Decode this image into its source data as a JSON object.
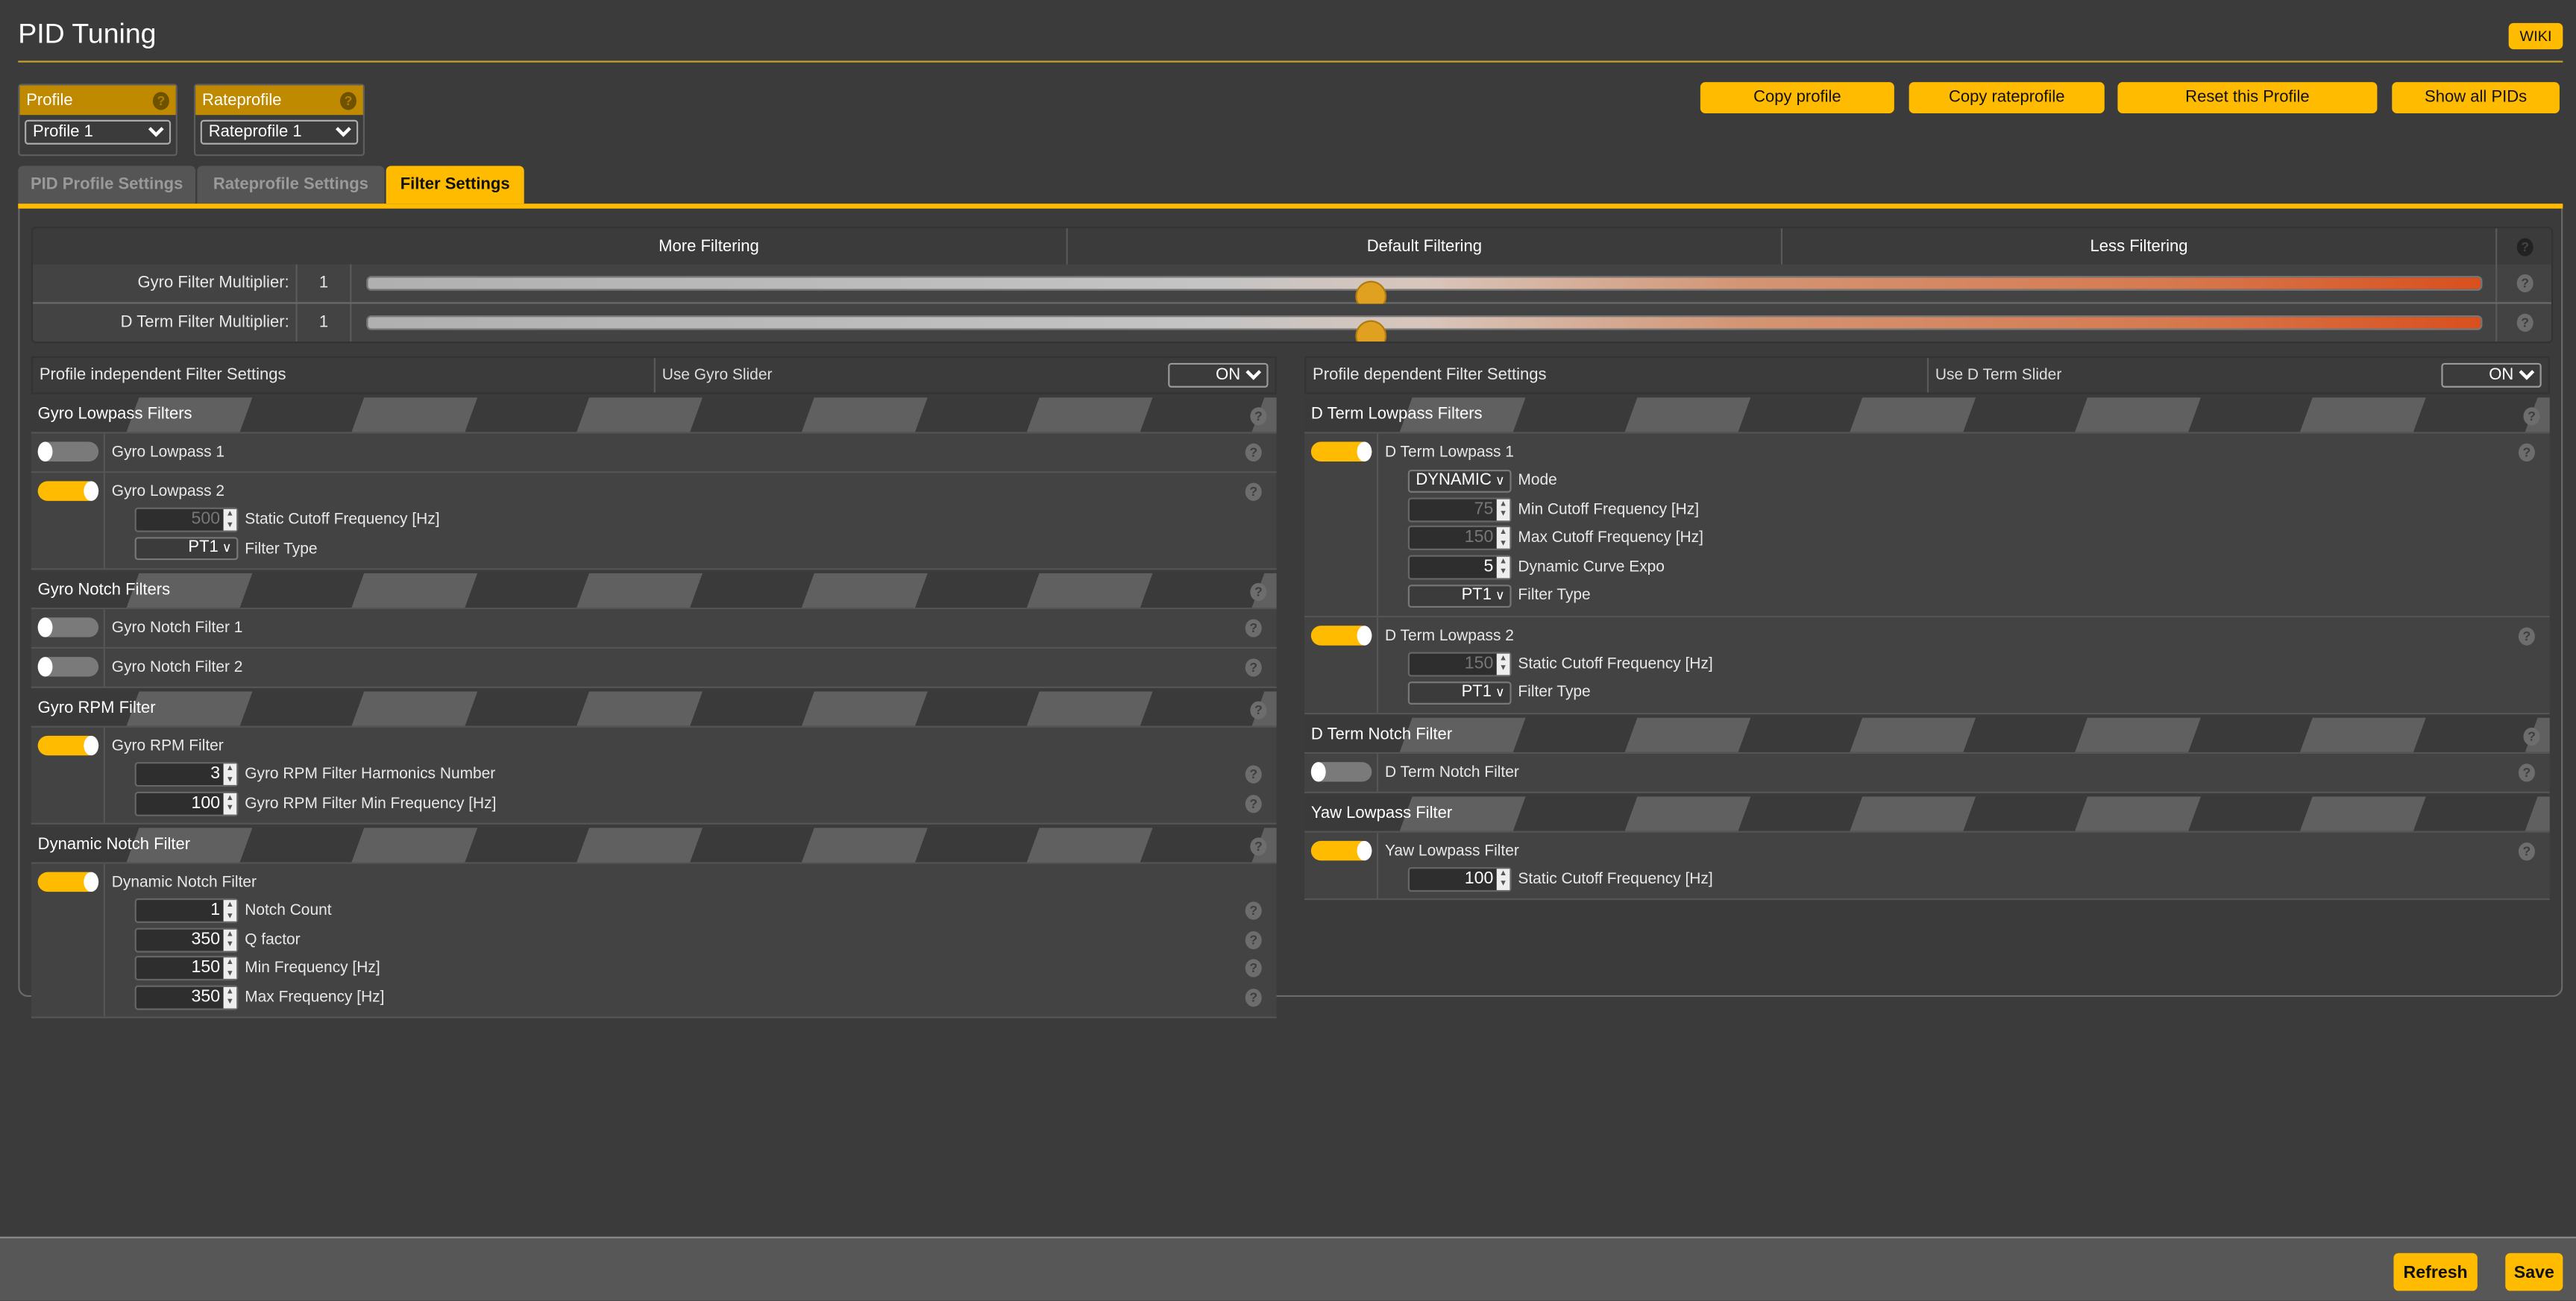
{
  "header": {
    "title": "PID Tuning",
    "wiki_label": "WIKI"
  },
  "profile": {
    "label": "Profile",
    "selected": "Profile 1"
  },
  "rateprofile": {
    "label": "Rateprofile",
    "selected": "Rateprofile 1"
  },
  "actions": {
    "copy_profile": "Copy profile",
    "copy_rateprofile": "Copy rateprofile",
    "reset_profile": "Reset this Profile",
    "show_all_pids": "Show all PIDs"
  },
  "tabs": [
    {
      "label": "PID Profile Settings",
      "active": false
    },
    {
      "label": "Rateprofile Settings",
      "active": false
    },
    {
      "label": "Filter Settings",
      "active": true
    }
  ],
  "sliders": {
    "headers": [
      "More Filtering",
      "Default Filtering",
      "Less Filtering"
    ],
    "rows": [
      {
        "label": "Gyro Filter Multiplier:",
        "value": "1",
        "position_fraction": 0.474
      },
      {
        "label": "D Term Filter Multiplier:",
        "value": "1",
        "position_fraction": 0.474
      }
    ]
  },
  "left": {
    "title": "Profile independent Filter Settings",
    "slider_label": "Use Gyro Slider",
    "slider_value": "ON",
    "sections": [
      {
        "title": "Gyro Lowpass Filters",
        "help": true,
        "items": [
          {
            "label": "Gyro Lowpass 1",
            "enabled": false,
            "help": true,
            "fields": []
          },
          {
            "label": "Gyro Lowpass 2",
            "enabled": true,
            "help": true,
            "fields": [
              {
                "type": "number",
                "value": "500",
                "disabled": true,
                "label": "Static Cutoff Frequency [Hz]"
              },
              {
                "type": "select",
                "value": "PT1",
                "label": "Filter Type"
              }
            ]
          }
        ]
      },
      {
        "title": "Gyro Notch Filters",
        "help": true,
        "items": [
          {
            "label": "Gyro Notch Filter 1",
            "enabled": false,
            "help": true,
            "fields": []
          },
          {
            "label": "Gyro Notch Filter 2",
            "enabled": false,
            "help": true,
            "fields": []
          }
        ]
      },
      {
        "title": "Gyro RPM Filter",
        "help": true,
        "items": [
          {
            "label": "Gyro RPM Filter",
            "enabled": true,
            "help": false,
            "fields": [
              {
                "type": "number",
                "value": "3",
                "label": "Gyro RPM Filter Harmonics Number",
                "help": true
              },
              {
                "type": "number",
                "value": "100",
                "label": "Gyro RPM Filter Min Frequency [Hz]",
                "help": true
              }
            ]
          }
        ]
      },
      {
        "title": "Dynamic Notch Filter",
        "help": true,
        "items": [
          {
            "label": "Dynamic Notch Filter",
            "enabled": true,
            "help": false,
            "fields": [
              {
                "type": "number",
                "value": "1",
                "label": "Notch Count",
                "help": true
              },
              {
                "type": "number",
                "value": "350",
                "label": "Q factor",
                "help": true
              },
              {
                "type": "number",
                "value": "150",
                "label": "Min Frequency [Hz]",
                "help": true
              },
              {
                "type": "number",
                "value": "350",
                "label": "Max Frequency [Hz]",
                "help": true
              }
            ]
          }
        ]
      }
    ]
  },
  "right": {
    "title": "Profile dependent Filter Settings",
    "slider_label": "Use D Term Slider",
    "slider_value": "ON",
    "sections": [
      {
        "title": "D Term Lowpass Filters",
        "help": true,
        "items": [
          {
            "label": "D Term Lowpass 1",
            "enabled": true,
            "help": true,
            "fields": [
              {
                "type": "select",
                "value": "DYNAMIC",
                "label": "Mode"
              },
              {
                "type": "number",
                "value": "75",
                "disabled": true,
                "label": "Min Cutoff Frequency [Hz]"
              },
              {
                "type": "number",
                "value": "150",
                "disabled": true,
                "label": "Max Cutoff Frequency [Hz]"
              },
              {
                "type": "number",
                "value": "5",
                "label": "Dynamic Curve Expo"
              },
              {
                "type": "select",
                "value": "PT1",
                "label": "Filter Type"
              }
            ]
          },
          {
            "label": "D Term Lowpass 2",
            "enabled": true,
            "help": true,
            "fields": [
              {
                "type": "number",
                "value": "150",
                "disabled": true,
                "label": "Static Cutoff Frequency [Hz]"
              },
              {
                "type": "select",
                "value": "PT1",
                "label": "Filter Type"
              }
            ]
          }
        ]
      },
      {
        "title": "D Term Notch Filter",
        "help": true,
        "items": [
          {
            "label": "D Term Notch Filter",
            "enabled": false,
            "help": true,
            "fields": []
          }
        ]
      },
      {
        "title": "Yaw Lowpass Filter",
        "help": false,
        "items": [
          {
            "label": "Yaw Lowpass Filter",
            "enabled": true,
            "help": true,
            "fields": [
              {
                "type": "number",
                "value": "100",
                "label": "Static Cutoff Frequency [Hz]"
              }
            ]
          }
        ]
      }
    ]
  },
  "footer": {
    "refresh_label": "Refresh",
    "save_label": "Save"
  },
  "colors": {
    "accent": "#ffbb00",
    "profile_header": "#c08a00",
    "background": "#3a3b3a",
    "slider_end": "#d9501e"
  }
}
